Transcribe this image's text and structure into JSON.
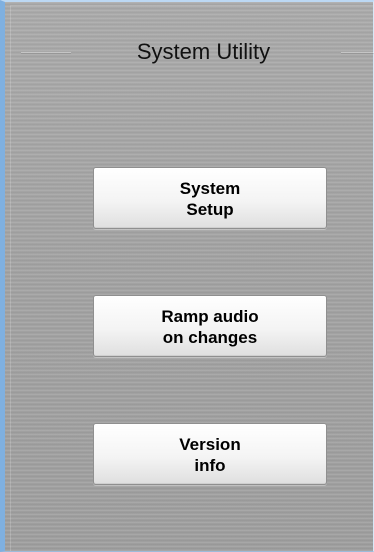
{
  "panel": {
    "title": "System Utility"
  },
  "buttons": {
    "system_setup": "System\nSetup",
    "ramp_audio": "Ramp audio\non changes",
    "version_info": "Version\ninfo"
  },
  "colors": {
    "window_frame": "#7fb0e0",
    "panel_background": "#a3a3a3",
    "button_face": "#f4f4f4",
    "text": "#000000"
  }
}
